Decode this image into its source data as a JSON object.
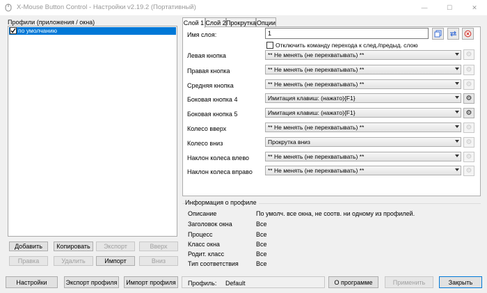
{
  "window": {
    "title": "X-Mouse Button Control - Настройки v2.19.2 (Портативный)",
    "controls": {
      "minimize": "—",
      "maximize": "☐",
      "close": "✕"
    }
  },
  "profiles": {
    "label": "Профили (приложения / окна)",
    "items": [
      {
        "name": "по умолчанию",
        "checked": true,
        "selected": true
      }
    ],
    "buttons": {
      "add": "Добавить",
      "copy": "Копировать",
      "export": "Экспорт",
      "up": "Вверх",
      "edit": "Правка",
      "delete": "Удалить",
      "import": "Импорт",
      "down": "Вниз"
    }
  },
  "tabs": [
    {
      "label": "Слой 1",
      "active": true
    },
    {
      "label": "Слой 2",
      "active": false
    },
    {
      "label": "Прокрутка",
      "active": false
    },
    {
      "label": "Опции",
      "active": false
    }
  ],
  "layer": {
    "name_label": "Имя слоя:",
    "name_value": "1",
    "disable_switch_label": "Отключить команду перехода к след./предыд. слою",
    "rows": [
      {
        "label": "Левая кнопка",
        "value": "** Не менять (не перехватывать) **",
        "gear_enabled": false
      },
      {
        "label": "Правая кнопка",
        "value": "** Не менять (не перехватывать) **",
        "gear_enabled": false
      },
      {
        "label": "Средняя кнопка",
        "value": "** Не менять (не перехватывать) **",
        "gear_enabled": false
      },
      {
        "label": "Боковая кнопка 4",
        "value": "Имитация клавиш: (нажато){F1}",
        "gear_enabled": true
      },
      {
        "label": "Боковая кнопка 5",
        "value": "Имитация клавиш: (нажато){F1}",
        "gear_enabled": true
      },
      {
        "label": "Колесо вверх",
        "value": "** Не менять (не перехватывать) **",
        "gear_enabled": false
      },
      {
        "label": "Колесо вниз",
        "value": "Прокрутка вниз",
        "gear_enabled": false
      },
      {
        "label": "Наклон колеса влево",
        "value": "** Не менять (не перехватывать) **",
        "gear_enabled": false
      },
      {
        "label": "Наклон колеса вправо",
        "value": "** Не менять (не перехватывать) **",
        "gear_enabled": false
      }
    ]
  },
  "profile_info": {
    "title": "Информация о профиле",
    "rows": [
      {
        "key": "Описание",
        "value": "По умолч. все окна, не соотв. ни одному из профилей."
      },
      {
        "key": "Заголовок окна",
        "value": "Все"
      },
      {
        "key": "Процесс",
        "value": "Все"
      },
      {
        "key": "Класс окна",
        "value": "Все"
      },
      {
        "key": "Родит. класс",
        "value": "Все"
      },
      {
        "key": "Тип соответствия",
        "value": "Все"
      }
    ]
  },
  "footer": {
    "settings": "Настройки",
    "export_profile": "Экспорт профиля",
    "import_profile": "Импорт профиля",
    "profile_label": "Профиль:",
    "profile_value": "Default",
    "about": "О программе",
    "apply": "Применить",
    "close": "Закрыть"
  },
  "colors": {
    "selection": "#0078d7",
    "copy_icon": "#3b6fd6",
    "reset_icon": "#d0342c"
  }
}
